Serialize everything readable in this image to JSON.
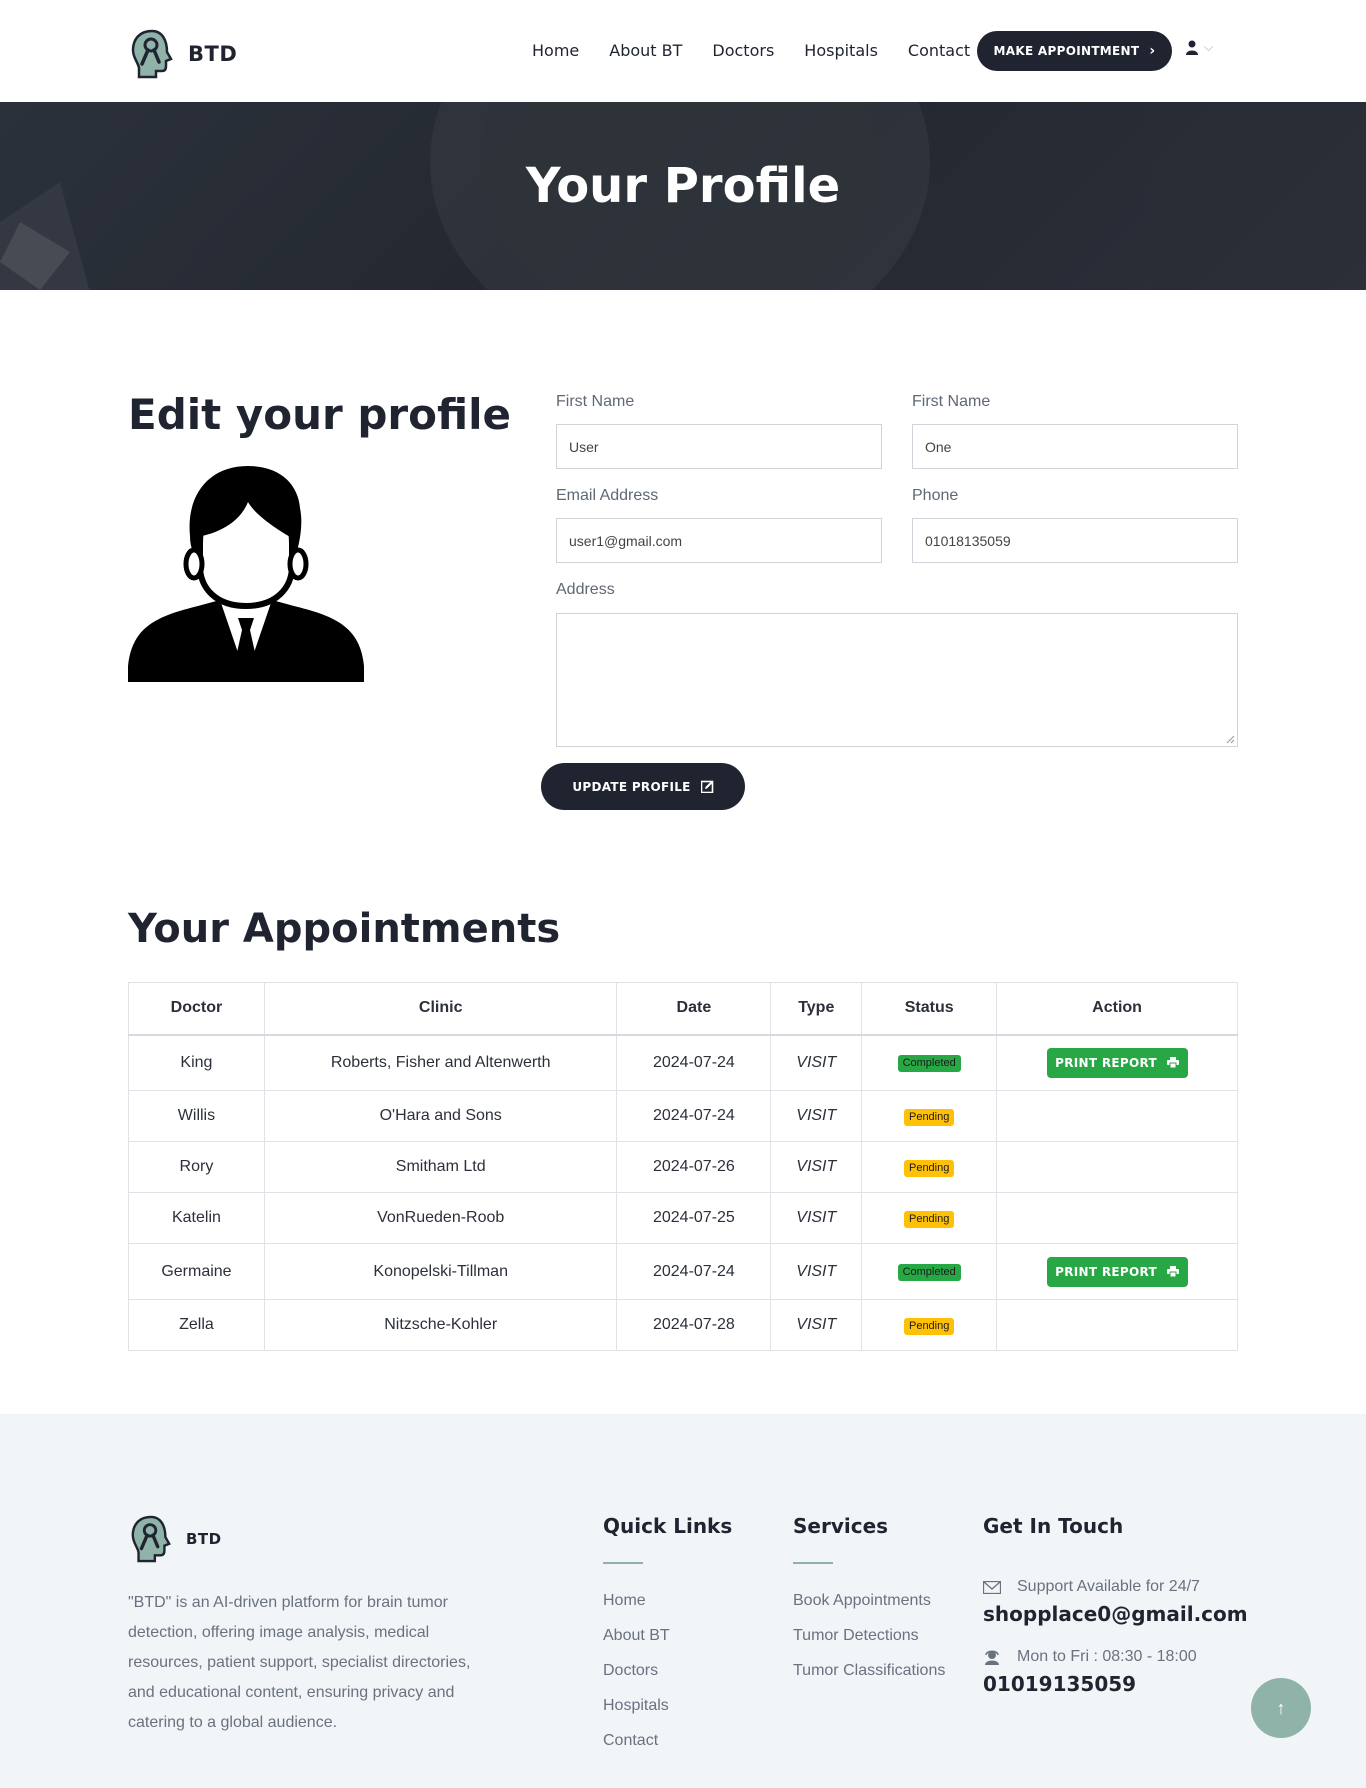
{
  "brand": {
    "name": "BTD",
    "accent": "#8fb3a9",
    "dark": "#1f2430"
  },
  "nav": {
    "items": [
      "Home",
      "About BT",
      "Doctors",
      "Hospitals",
      "Contact"
    ],
    "cta": "MAKE APPOINTMENT"
  },
  "hero": {
    "title": "Your Profile"
  },
  "profile": {
    "heading": "Edit your profile",
    "labels": {
      "first_name": "First Name",
      "last_name": "First Name",
      "email": "Email Address",
      "phone": "Phone",
      "address": "Address"
    },
    "values": {
      "first_name": "User",
      "last_name": "One",
      "email": "user1@gmail.com",
      "phone": "01018135059",
      "address": ""
    },
    "update_button": "UPDATE PROFILE"
  },
  "appointments": {
    "heading": "Your Appointments",
    "columns": [
      "Doctor",
      "Clinic",
      "Date",
      "Type",
      "Status",
      "Action"
    ],
    "rows": [
      {
        "doctor": "King",
        "clinic": "Roberts, Fisher and Altenwerth",
        "date": "2024-07-24",
        "type": "VISIT",
        "status": "Completed",
        "action": "PRINT REPORT"
      },
      {
        "doctor": "Willis",
        "clinic": "O'Hara and Sons",
        "date": "2024-07-24",
        "type": "VISIT",
        "status": "Pending",
        "action": ""
      },
      {
        "doctor": "Rory",
        "clinic": "Smitham Ltd",
        "date": "2024-07-26",
        "type": "VISIT",
        "status": "Pending",
        "action": ""
      },
      {
        "doctor": "Katelin",
        "clinic": "VonRueden-Roob",
        "date": "2024-07-25",
        "type": "VISIT",
        "status": "Pending",
        "action": ""
      },
      {
        "doctor": "Germaine",
        "clinic": "Konopelski-Tillman",
        "date": "2024-07-24",
        "type": "VISIT",
        "status": "Completed",
        "action": "PRINT REPORT"
      },
      {
        "doctor": "Zella",
        "clinic": "Nitzsche-Kohler",
        "date": "2024-07-28",
        "type": "VISIT",
        "status": "Pending",
        "action": ""
      }
    ],
    "status_colors": {
      "Completed": "#28a745",
      "Pending": "#ffc107"
    }
  },
  "footer": {
    "brand": "BTD",
    "about": "\"BTD\" is an AI-driven platform for brain tumor detection, offering image analysis, medical resources, patient support, specialist directories, and educational content, ensuring privacy and catering to a global audience.",
    "quick_links": {
      "title": "Quick Links",
      "items": [
        "Home",
        "About BT",
        "Doctors",
        "Hospitals",
        "Contact"
      ]
    },
    "services": {
      "title": "Services",
      "items": [
        "Book Appointments",
        "Tumor Detections",
        "Tumor Classifications"
      ]
    },
    "contact": {
      "title": "Get In Touch",
      "support_label": "Support Available for 24/7",
      "email": "shopplace0@gmail.com",
      "hours_label": "Mon to Fri : 08:30 - 18:00",
      "phone": "01019135059"
    }
  },
  "scroll_top": "↑"
}
